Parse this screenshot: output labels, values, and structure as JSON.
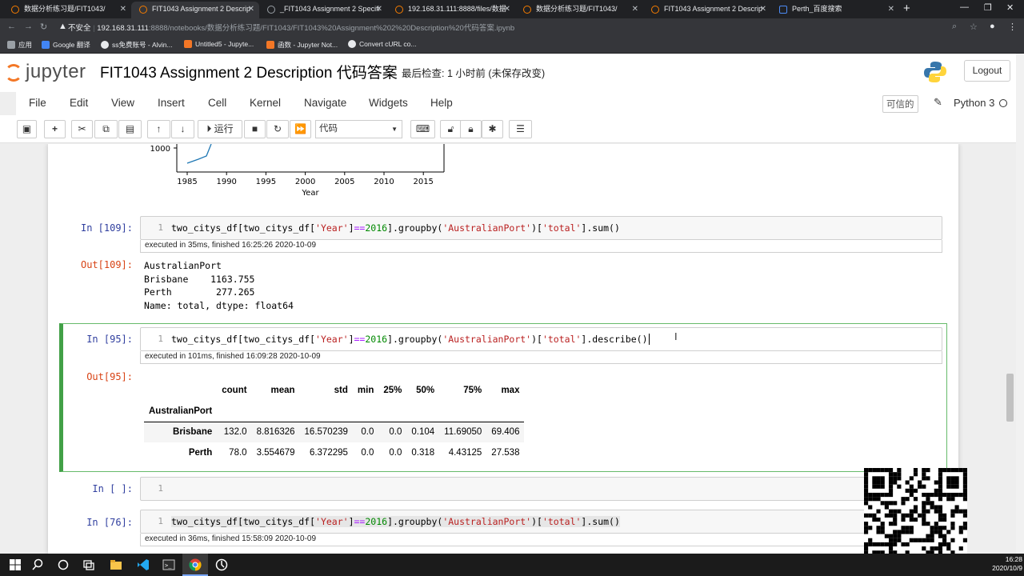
{
  "browser": {
    "tabs": [
      {
        "title": "数据分析练习题/FIT1043/",
        "active": false
      },
      {
        "title": "FIT1043 Assignment 2 Descrip",
        "active": true
      },
      {
        "title": "_FIT1043 Assignment 2 Specifi",
        "active": false
      },
      {
        "title": "192.168.31.111:8888/files/数据",
        "active": false
      },
      {
        "title": "数据分析练习题/FIT1043/",
        "active": false
      },
      {
        "title": "FIT1043 Assignment 2 Descrip",
        "active": false
      },
      {
        "title": "Perth_百度搜索",
        "active": false
      }
    ],
    "address": {
      "security": "不安全",
      "host": "192.168.31.111",
      "path": ":8888/notebooks/数据分析练习题/FIT1043/FIT1043%20Assignment%202%20Description%20代码答案.ipynb"
    },
    "bookmarks": [
      "应用",
      "Google 翻译",
      "ss免费账号 - Alvin...",
      "Untitled5 - Jupyte...",
      "函数 - Jupyter Not...",
      "Convert cURL co..."
    ]
  },
  "jupyter": {
    "logo_text": "jupyter",
    "notebook_title": "FIT1043 Assignment 2 Description 代码答案",
    "checkpoint": "最后检查: 1 小时前 (未保存改变)",
    "logout": "Logout",
    "menu": [
      "File",
      "Edit",
      "View",
      "Insert",
      "Cell",
      "Kernel",
      "Navigate",
      "Widgets",
      "Help"
    ],
    "trusted": "可信的",
    "kernel": "Python 3",
    "toolbar": {
      "run_label": "运行",
      "cell_type": "代码"
    }
  },
  "plot": {
    "ytick": "1000",
    "xticks": [
      "1985",
      "1990",
      "1995",
      "2000",
      "2005",
      "2010",
      "2015"
    ],
    "xlabel": "Year"
  },
  "cells": {
    "c109": {
      "in_prompt": "In  [109]:",
      "line_no": "1",
      "code_a": "two_citys_df[two_citys_df[",
      "code_s1": "'Year'",
      "code_b": "]",
      "code_op": "==",
      "code_n": "2016",
      "code_c": "].groupby(",
      "code_s2": "'AustralianPort'",
      "code_d": ")[",
      "code_s3": "'total'",
      "code_e": "].sum()",
      "exec": "executed in 35ms, finished 16:25:26 2020-10-09",
      "out_prompt": "Out[109]:",
      "output": "AustralianPort\nBrisbane    1163.755\nPerth        277.265\nName: total, dtype: float64"
    },
    "c95": {
      "in_prompt": "In  [95]:",
      "line_no": "1",
      "code_a": "two_citys_df[two_citys_df[",
      "code_s1": "'Year'",
      "code_b": "]",
      "code_op": "==",
      "code_n": "2016",
      "code_c": "].groupby(",
      "code_s2": "'AustralianPort'",
      "code_d": ")[",
      "code_s3": "'total'",
      "code_e": "].describe()",
      "exec": "executed in 101ms, finished 16:09:28 2020-10-09",
      "out_prompt": "Out[95]:",
      "table": {
        "columns": [
          "count",
          "mean",
          "std",
          "min",
          "25%",
          "50%",
          "75%",
          "max"
        ],
        "index_name": "AustralianPort",
        "rows": [
          {
            "label": "Brisbane",
            "values": [
              "132.0",
              "8.816326",
              "16.570239",
              "0.0",
              "0.0",
              "0.104",
              "11.69050",
              "69.406"
            ]
          },
          {
            "label": "Perth",
            "values": [
              "78.0",
              "3.554679",
              "6.372295",
              "0.0",
              "0.0",
              "0.318",
              "4.43125",
              "27.538"
            ]
          }
        ]
      }
    },
    "empty": {
      "in_prompt": "In  [ ]:",
      "line_no": "1"
    },
    "c76": {
      "in_prompt": "In  [76]:",
      "line_no": "1",
      "code_a": "two_citys_df[two_citys_df[",
      "code_s1": "'Year'",
      "code_b": "]",
      "code_op": "==",
      "code_n": "2016",
      "code_c": "].groupby(",
      "code_s2": "'AustralianPort'",
      "code_d": ")[",
      "code_s3": "'total'",
      "code_e": "].sum()",
      "exec": "executed in 36ms, finished 15:58:09 2020-10-09"
    }
  },
  "taskbar": {
    "time": "16:28",
    "date": "2020/10/9"
  },
  "colors": {
    "accent": "#f37726",
    "selected_border": "#42a047"
  }
}
